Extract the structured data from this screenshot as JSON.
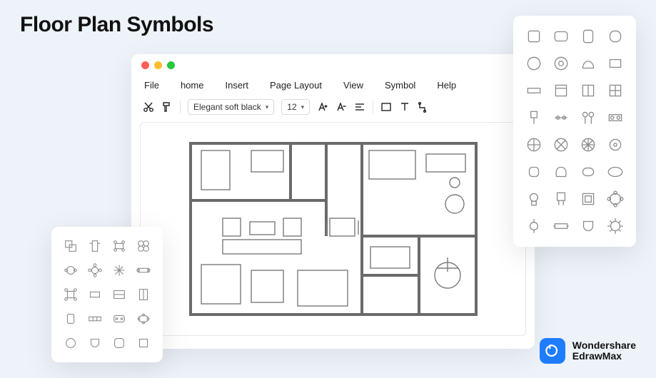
{
  "page_title": "Floor Plan Symbols",
  "editor": {
    "menu": [
      "File",
      "home",
      "Insert",
      "Page Layout",
      "View",
      "Symbol",
      "Help"
    ],
    "font_select": "Elegant soft black",
    "size_select": "12"
  },
  "brand": {
    "line1": "Wondershare",
    "line2": "EdrawMax"
  },
  "palettes": {
    "right_label": "furniture-symbols-large",
    "left_label": "table-layout-symbols"
  }
}
